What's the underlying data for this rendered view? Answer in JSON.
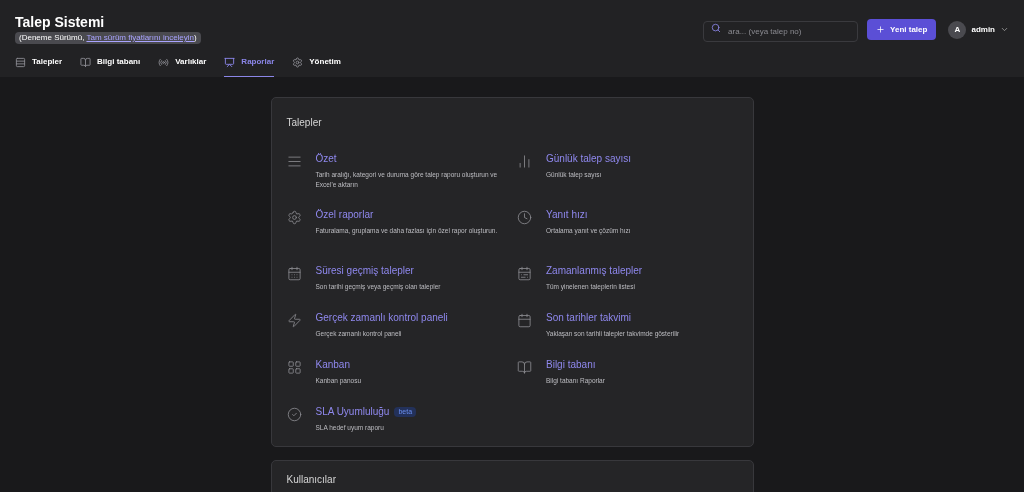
{
  "header": {
    "title": "Talep Sistemi",
    "trial_prefix": "(Deneme Sürümü, ",
    "trial_link": "Tam sürüm fiyatlarını inceleyin",
    "trial_suffix": ")",
    "search": {
      "placeholder": "ara... (veya talep no)"
    },
    "new_button": "Yeni talep",
    "user": {
      "initial": "A",
      "name": "admin"
    }
  },
  "tabs": [
    {
      "label": "Talepler",
      "selected": false
    },
    {
      "label": "Bilgi tabanı",
      "selected": false
    },
    {
      "label": "Varlıklar",
      "selected": false
    },
    {
      "label": "Raporlar",
      "selected": true
    },
    {
      "label": "Yönetim",
      "selected": false
    }
  ],
  "sections": [
    {
      "title": "Talepler",
      "items": [
        {
          "title": "Özet",
          "description": "Tarih aralığı, kategori ve duruma göre talep raporu oluşturun ve Excel'e aktarın"
        },
        {
          "title": "Günlük talep sayısı",
          "description": "Günlük talep sayısı"
        },
        {
          "title": "Özel raporlar",
          "description": "Faturalama, gruplama ve daha fazlası için özel rapor oluşturun."
        },
        {
          "title": "Yanıt hızı",
          "description": "Ortalama yanıt ve çözüm hızı"
        },
        {
          "title": "Süresi geçmiş talepler",
          "description": "Son tarihi geçmiş veya geçmiş olan talepler"
        },
        {
          "title": "Zamanlanmış talepler",
          "description": "Tüm yinelenen taleplerin listesi"
        },
        {
          "title": "Gerçek zamanlı kontrol paneli",
          "description": "Gerçek zamanlı kontrol paneli"
        },
        {
          "title": "Son tarihler takvimi",
          "description": "Yaklaşan son tarihli talepler takvimde gösterilir"
        },
        {
          "title": "Kanban",
          "description": "Kanban panosu"
        },
        {
          "title": "Bilgi tabanı",
          "description": "Bilgi tabanı Raporlar"
        },
        {
          "title": "SLA Uyumluluğu",
          "badge": "beta",
          "description": "SLA hedef uyum raporu"
        }
      ]
    },
    {
      "title": "Kullanıcılar"
    }
  ]
}
